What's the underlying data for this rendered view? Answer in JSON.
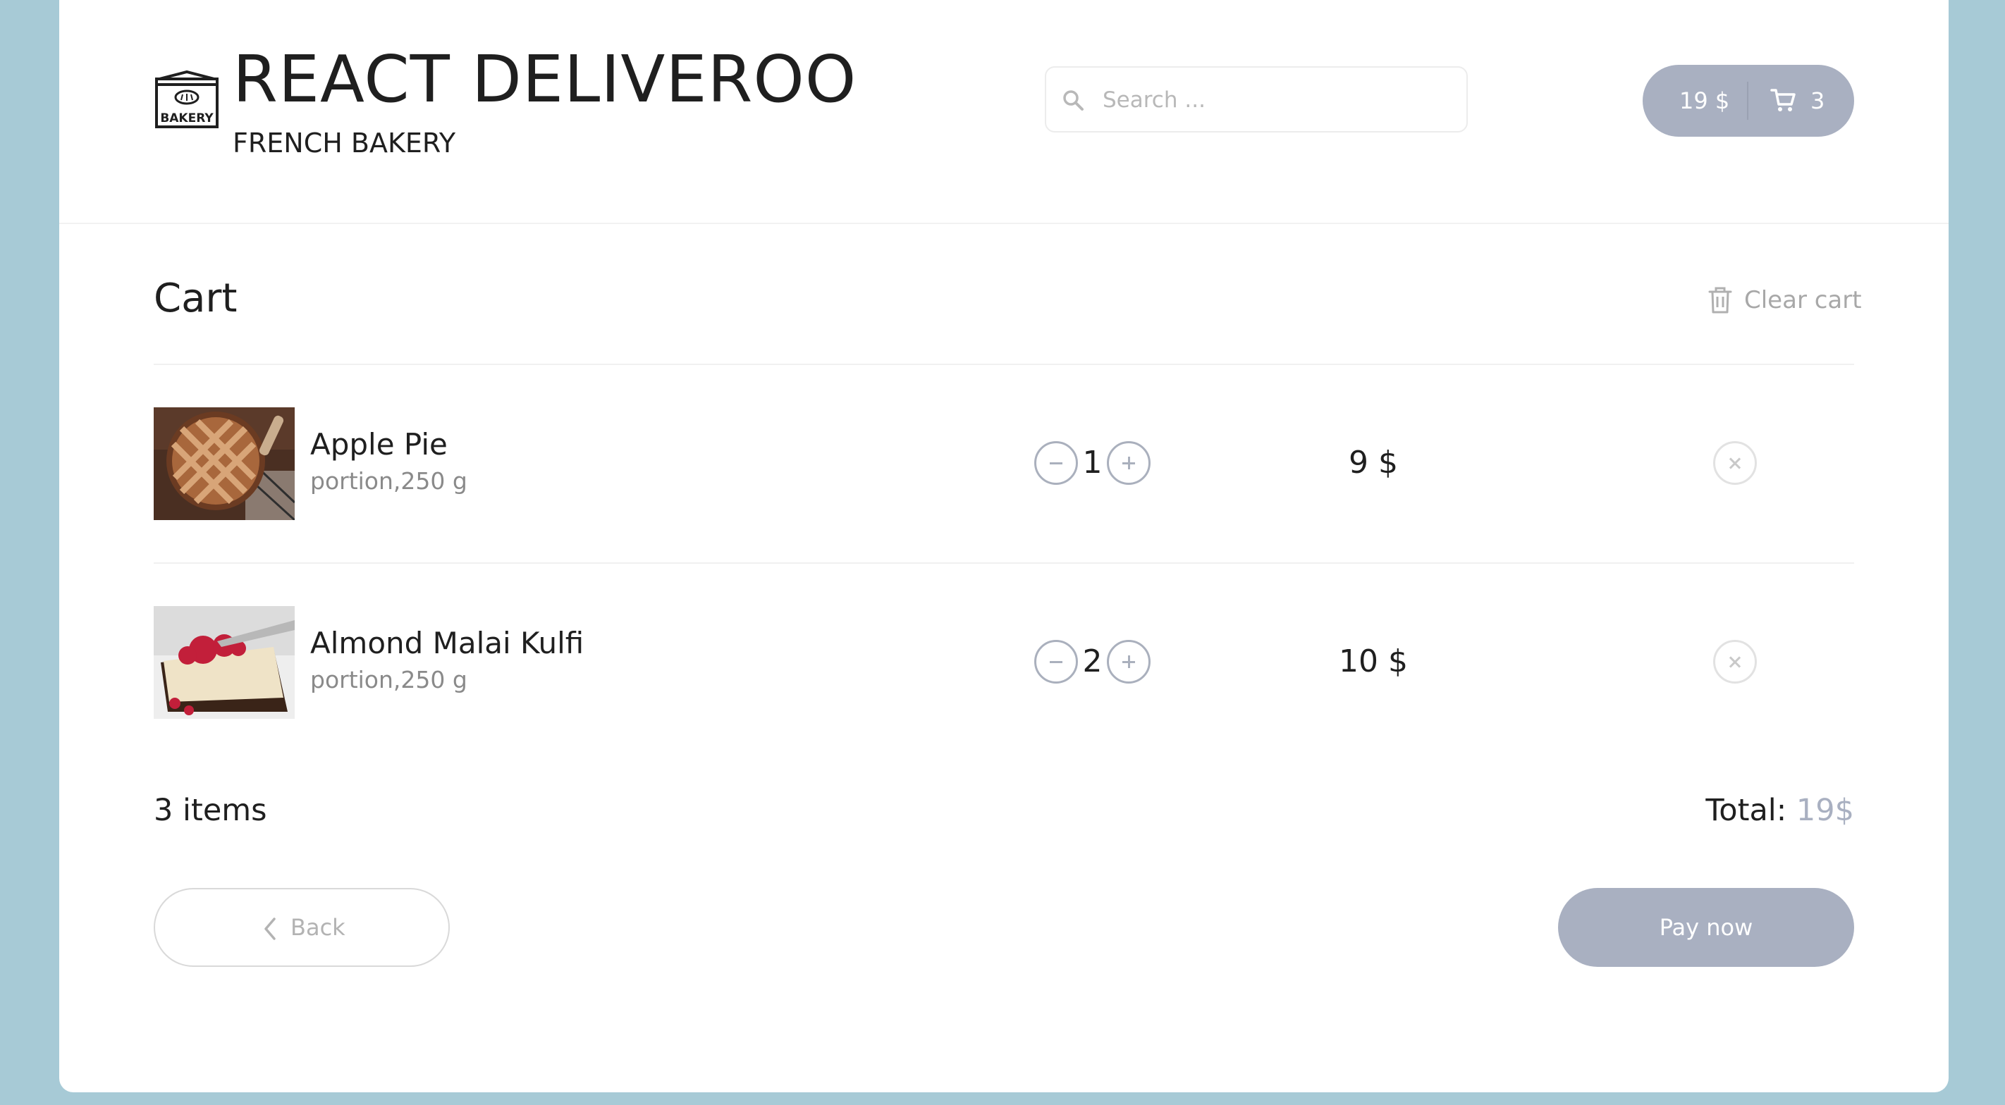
{
  "header": {
    "logo_text": "BAKERY",
    "title": "REACT DELIVEROO",
    "subtitle": "FRENCH BAKERY",
    "search_placeholder": "Search ...",
    "search_icon": "search-icon",
    "cart_amount": "19 $",
    "cart_count": "3",
    "cart_icon": "shopping-cart-icon"
  },
  "cart": {
    "title": "Cart",
    "clear_label": "Clear cart",
    "clear_icon": "trash-icon",
    "items": [
      {
        "name": "Apple Pie",
        "portion": "portion,250 g",
        "quantity": "1",
        "price": "9 $",
        "image": "apple-pie-photo"
      },
      {
        "name": "Almond Malai Kulfi",
        "portion": "portion,250 g",
        "quantity": "2",
        "price": "10 $",
        "image": "kulfi-cheesecake-photo"
      }
    ],
    "items_count": "3 items",
    "total_label": "Total: ",
    "total_value": "19$",
    "back_label": "Back",
    "pay_label": "Pay now"
  },
  "colors": {
    "page_background": "#a7cad6",
    "accent": "#a9b0c1",
    "card": "#ffffff"
  }
}
